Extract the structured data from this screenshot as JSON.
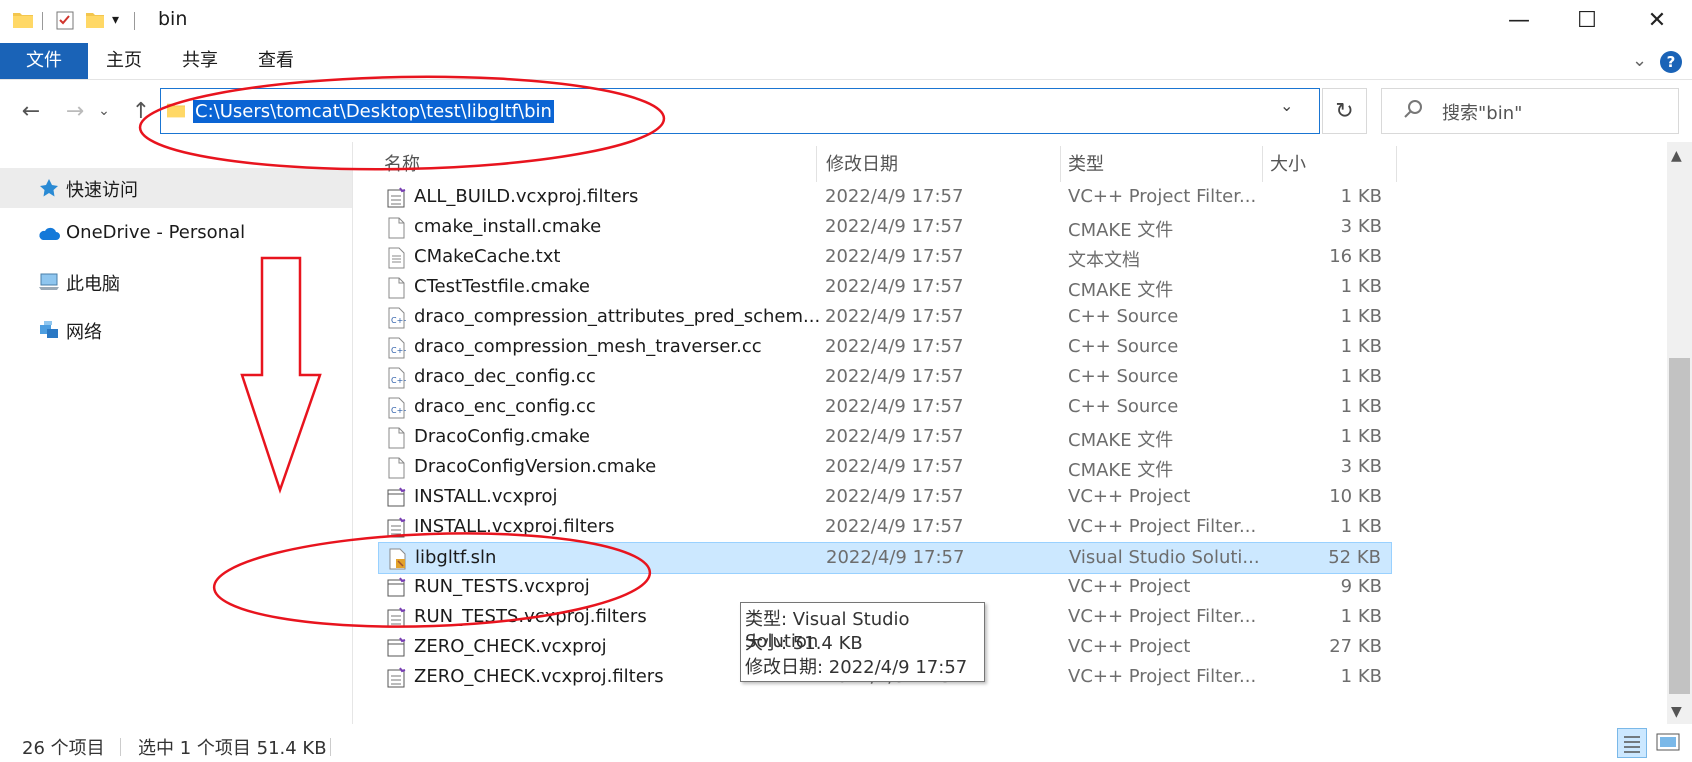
{
  "window": {
    "title": "bin",
    "minimize": "—",
    "maximize": "☐",
    "close": "✕"
  },
  "ribbon": {
    "tabs": [
      "文件",
      "主页",
      "共享",
      "查看"
    ],
    "collapse": "⌄",
    "help": "?"
  },
  "address": {
    "path": "C:\\Users\\tomcat\\Desktop\\test\\libgltf\\bin",
    "search_placeholder": "搜索\"bin\""
  },
  "nav": {
    "items": [
      {
        "label": "快速访问",
        "icon": "star-icon"
      },
      {
        "label": "OneDrive - Personal",
        "icon": "cloud-icon"
      },
      {
        "label": "此电脑",
        "icon": "computer-icon"
      },
      {
        "label": "网络",
        "icon": "network-icon"
      }
    ]
  },
  "columns": {
    "name": "名称",
    "date": "修改日期",
    "type": "类型",
    "size": "大小"
  },
  "files": [
    {
      "name": "ALL_BUILD.vcxproj.filters",
      "date": "2022/4/9 17:57",
      "type": "VC++ Project Filter...",
      "size": "1 KB",
      "icon": "vcxproj-filters-icon"
    },
    {
      "name": "cmake_install.cmake",
      "date": "2022/4/9 17:57",
      "type": "CMAKE 文件",
      "size": "3 KB",
      "icon": "blank-file-icon"
    },
    {
      "name": "CMakeCache.txt",
      "date": "2022/4/9 17:57",
      "type": "文本文档",
      "size": "16 KB",
      "icon": "text-file-icon"
    },
    {
      "name": "CTestTestfile.cmake",
      "date": "2022/4/9 17:57",
      "type": "CMAKE 文件",
      "size": "1 KB",
      "icon": "blank-file-icon"
    },
    {
      "name": "draco_compression_attributes_pred_schem...",
      "date": "2022/4/9 17:57",
      "type": "C++ Source",
      "size": "1 KB",
      "icon": "cpp-file-icon"
    },
    {
      "name": "draco_compression_mesh_traverser.cc",
      "date": "2022/4/9 17:57",
      "type": "C++ Source",
      "size": "1 KB",
      "icon": "cpp-file-icon"
    },
    {
      "name": "draco_dec_config.cc",
      "date": "2022/4/9 17:57",
      "type": "C++ Source",
      "size": "1 KB",
      "icon": "cpp-file-icon"
    },
    {
      "name": "draco_enc_config.cc",
      "date": "2022/4/9 17:57",
      "type": "C++ Source",
      "size": "1 KB",
      "icon": "cpp-file-icon"
    },
    {
      "name": "DracoConfig.cmake",
      "date": "2022/4/9 17:57",
      "type": "CMAKE 文件",
      "size": "1 KB",
      "icon": "blank-file-icon"
    },
    {
      "name": "DracoConfigVersion.cmake",
      "date": "2022/4/9 17:57",
      "type": "CMAKE 文件",
      "size": "3 KB",
      "icon": "blank-file-icon"
    },
    {
      "name": "INSTALL.vcxproj",
      "date": "2022/4/9 17:57",
      "type": "VC++ Project",
      "size": "10 KB",
      "icon": "vcxproj-icon"
    },
    {
      "name": "INSTALL.vcxproj.filters",
      "date": "2022/4/9 17:57",
      "type": "VC++ Project Filter...",
      "size": "1 KB",
      "icon": "vcxproj-filters-icon"
    },
    {
      "name": "libgltf.sln",
      "date": "2022/4/9 17:57",
      "type": "Visual Studio Soluti...",
      "size": "52 KB",
      "icon": "sln-file-icon",
      "selected": true
    },
    {
      "name": "RUN_TESTS.vcxproj",
      "date": "",
      "type": "VC++ Project",
      "size": "9 KB",
      "icon": "vcxproj-icon"
    },
    {
      "name": "RUN_TESTS.vcxproj.filters",
      "date": "",
      "type": "VC++ Project Filter...",
      "size": "1 KB",
      "icon": "vcxproj-filters-icon"
    },
    {
      "name": "ZERO_CHECK.vcxproj",
      "date": "",
      "type": "VC++ Project",
      "size": "27 KB",
      "icon": "vcxproj-icon"
    },
    {
      "name": "ZERO_CHECK.vcxproj.filters",
      "date": "2022/4/9 17:57",
      "type": "VC++ Project Filter...",
      "size": "1 KB",
      "icon": "vcxproj-filters-icon"
    }
  ],
  "tooltip": {
    "type_line": "类型: Visual Studio Solution",
    "size_line": "大小: 51.4 KB",
    "date_line": "修改日期: 2022/4/9 17:57"
  },
  "status": {
    "count": "26 个项目",
    "selection": "选中 1 个项目  51.4 KB"
  },
  "colors": {
    "accent": "#1a63b7",
    "selection": "#cce8ff",
    "annotation": "#e8141e"
  }
}
